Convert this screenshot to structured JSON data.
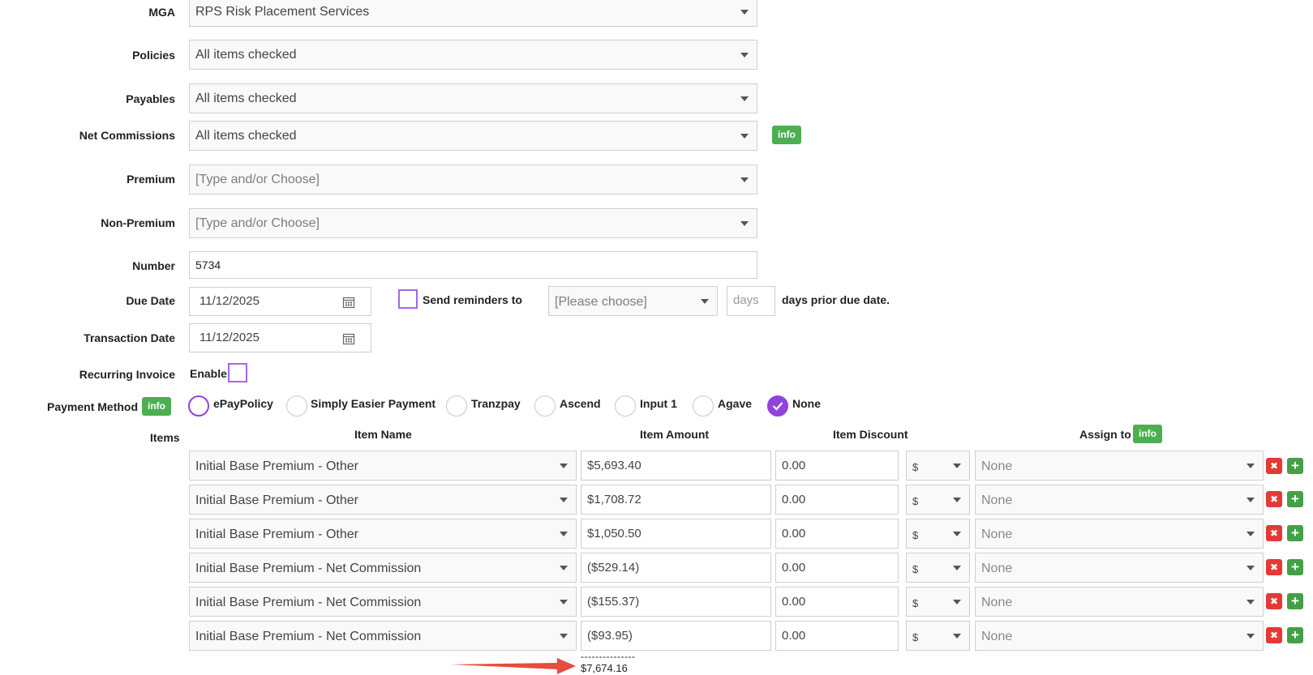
{
  "form": {
    "mga": {
      "label": "MGA",
      "value": "RPS Risk Placement Services"
    },
    "policies": {
      "label": "Policies",
      "value": "All items checked"
    },
    "payables": {
      "label": "Payables",
      "value": "All items checked"
    },
    "net_commissions": {
      "label": "Net Commissions",
      "value": "All items checked",
      "info": "info"
    },
    "premium": {
      "label": "Premium",
      "placeholder": "[Type and/or Choose]"
    },
    "non_premium": {
      "label": "Non-Premium",
      "placeholder": "[Type and/or Choose]"
    },
    "number": {
      "label": "Number",
      "value": "5734"
    },
    "due_date": {
      "label": "Due Date",
      "value": "11/12/2025"
    },
    "reminders": {
      "label": "Send reminders to",
      "select_placeholder": "[Please choose]",
      "days_placeholder": "days",
      "suffix": "days prior due date."
    },
    "transaction_date": {
      "label": "Transaction Date",
      "value": "11/12/2025"
    },
    "recurring": {
      "label": "Recurring Invoice",
      "enable_label": "Enable"
    },
    "payment_method": {
      "label": "Payment Method",
      "info": "info",
      "options": [
        "ePayPolicy",
        "Simply Easier Payment",
        "Tranzpay",
        "Ascend",
        "Input 1",
        "Agave",
        "None"
      ],
      "selected": "None"
    }
  },
  "items": {
    "label": "Items",
    "headers": {
      "name": "Item Name",
      "amount": "Item Amount",
      "discount": "Item Discount",
      "assign": "Assign to",
      "assign_info": "info"
    },
    "rows": [
      {
        "name": "Initial Base Premium - Other",
        "amount": "$5,693.40",
        "discount": "0.00",
        "unit": "$",
        "assign": "None"
      },
      {
        "name": "Initial Base Premium - Other",
        "amount": "$1,708.72",
        "discount": "0.00",
        "unit": "$",
        "assign": "None"
      },
      {
        "name": "Initial Base Premium - Other",
        "amount": "$1,050.50",
        "discount": "0.00",
        "unit": "$",
        "assign": "None"
      },
      {
        "name": "Initial Base Premium - Net Commission",
        "amount": "($529.14)",
        "discount": "0.00",
        "unit": "$",
        "assign": "None"
      },
      {
        "name": "Initial Base Premium - Net Commission",
        "amount": "($155.37)",
        "discount": "0.00",
        "unit": "$",
        "assign": "None"
      },
      {
        "name": "Initial Base Premium - Net Commission",
        "amount": "($93.95)",
        "discount": "0.00",
        "unit": "$",
        "assign": "None"
      }
    ],
    "separator": "---------------",
    "total": "$7,674.16"
  },
  "colors": {
    "accent": "#8e44dd",
    "info_badge": "#4caf50",
    "delete": "#e53935",
    "add": "#43a047",
    "arrow": "#e74c3c"
  }
}
